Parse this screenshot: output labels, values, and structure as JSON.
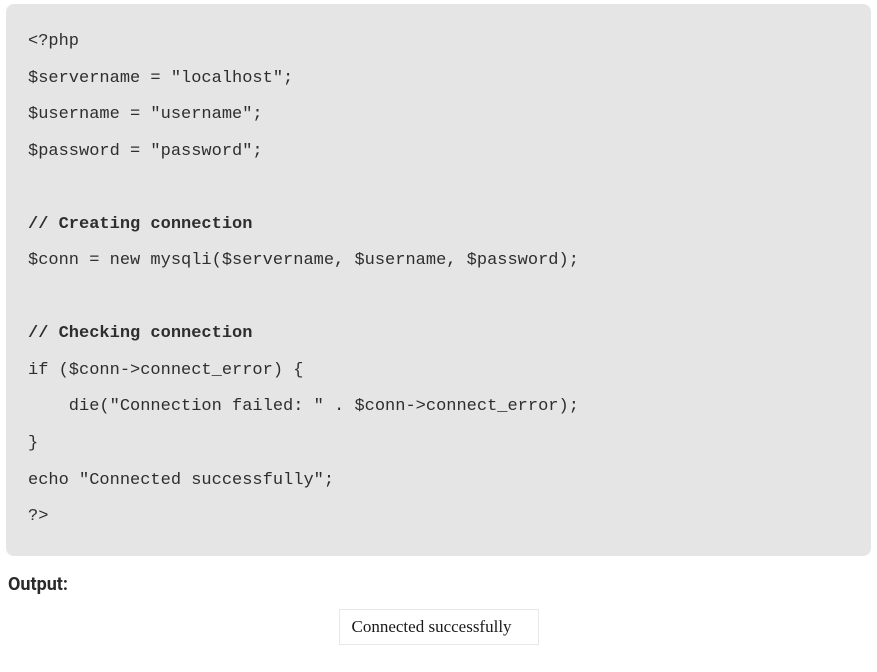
{
  "code": {
    "lines": [
      {
        "text": "<?php",
        "bold": false
      },
      {
        "text": "$servername = \"localhost\";",
        "bold": false
      },
      {
        "text": "$username = \"username\";",
        "bold": false
      },
      {
        "text": "$password = \"password\";",
        "bold": false
      },
      {
        "text": "",
        "bold": false
      },
      {
        "text": "// Creating connection",
        "bold": true
      },
      {
        "text": "$conn = new mysqli($servername, $username, $password);",
        "bold": false
      },
      {
        "text": "",
        "bold": false
      },
      {
        "text": "// Checking connection",
        "bold": true
      },
      {
        "text": "if ($conn->connect_error) {",
        "bold": false
      },
      {
        "text": "    die(\"Connection failed: \" . $conn->connect_error);",
        "bold": false
      },
      {
        "text": "}",
        "bold": false
      },
      {
        "text": "echo \"Connected successfully\";",
        "bold": false
      },
      {
        "text": "?>",
        "bold": false
      }
    ]
  },
  "output": {
    "label": "Output:",
    "result": "Connected successfully"
  }
}
